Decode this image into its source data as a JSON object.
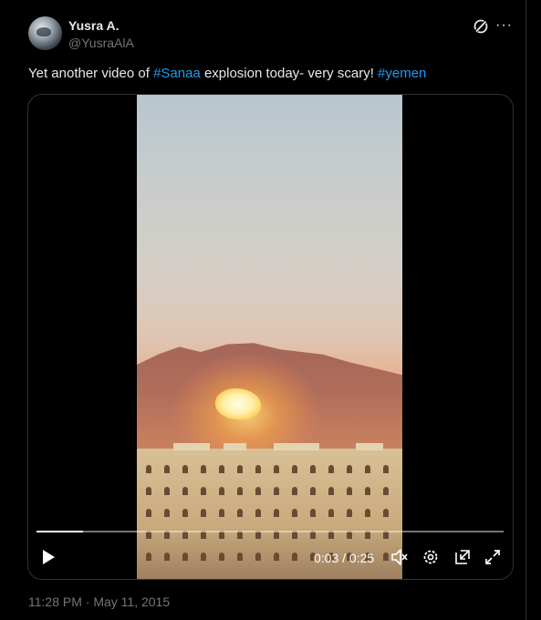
{
  "author": {
    "name": "Yusra A.",
    "handle": "@YusraAlA"
  },
  "tweet": {
    "text_before": "Yet another video of ",
    "hashtag1": "#Sanaa",
    "text_middle": " explosion today- very scary! ",
    "hashtag2": "#yemen"
  },
  "video": {
    "current_time": "0:03",
    "separator": " / ",
    "duration": "0:25",
    "progress_fraction": 0.1
  },
  "footer": {
    "timestamp": "11:28 PM · May 11, 2015"
  },
  "colors": {
    "hashtag": "#1d9bf0",
    "background": "#000000",
    "secondary_text": "#71767b"
  },
  "icons": [
    "grok-icon",
    "more-icon",
    "play-icon",
    "mute-icon",
    "settings-icon",
    "pip-icon",
    "fullscreen-icon"
  ]
}
